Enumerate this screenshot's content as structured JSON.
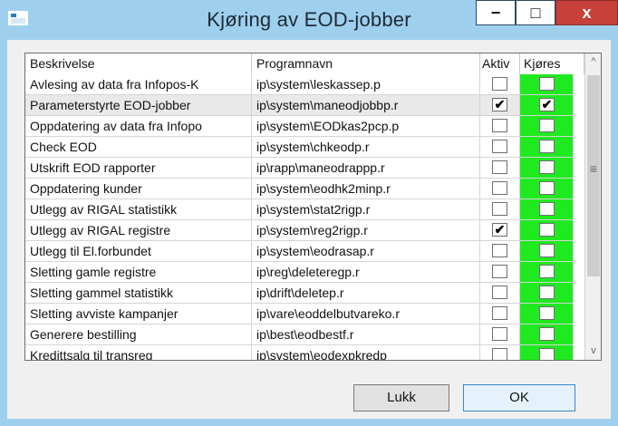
{
  "window": {
    "title": "Kjøring av EOD-jobber"
  },
  "titlebar": {
    "minimize": "−",
    "maximize": "□",
    "close": "x"
  },
  "grid": {
    "columns": [
      "Beskrivelse",
      "Programnavn",
      "Aktiv",
      "Kjøres"
    ],
    "rows": [
      {
        "desc": "Avlesing av data fra Infopos-K",
        "prog": "ip\\system\\leskassep.p",
        "aktiv": "",
        "kjores": ""
      },
      {
        "desc": "Parameterstyrte EOD-jobber",
        "prog": "ip\\system\\maneodjobbp.r",
        "aktiv": "✔",
        "kjores": "✔"
      },
      {
        "desc": "Oppdatering av data fra Infopo",
        "prog": "ip\\system\\EODkas2pcp.p",
        "aktiv": "",
        "kjores": ""
      },
      {
        "desc": "Check EOD",
        "prog": "ip\\system\\chkeodp.r",
        "aktiv": "",
        "kjores": ""
      },
      {
        "desc": "Utskrift EOD rapporter",
        "prog": "ip\\rapp\\maneodrappp.r",
        "aktiv": "",
        "kjores": ""
      },
      {
        "desc": "Oppdatering kunder",
        "prog": "ip\\system\\eodhk2minp.r",
        "aktiv": "",
        "kjores": ""
      },
      {
        "desc": "Utlegg av RIGAL statistikk",
        "prog": "ip\\system\\stat2rigp.r",
        "aktiv": "",
        "kjores": ""
      },
      {
        "desc": "Utlegg av RIGAL registre",
        "prog": "ip\\system\\reg2rigp.r",
        "aktiv": "✔",
        "kjores": ""
      },
      {
        "desc": "Utlegg til El.forbundet",
        "prog": "ip\\system\\eodrasap.r",
        "aktiv": "",
        "kjores": ""
      },
      {
        "desc": "Sletting gamle registre",
        "prog": "ip\\reg\\deleteregp.r",
        "aktiv": "",
        "kjores": ""
      },
      {
        "desc": "Sletting gammel statistikk",
        "prog": "ip\\drift\\deletep.r",
        "aktiv": "",
        "kjores": ""
      },
      {
        "desc": "Sletting avviste kampanjer",
        "prog": "ip\\vare\\eoddelbutvareko.r",
        "aktiv": "",
        "kjores": ""
      },
      {
        "desc": "Generere bestilling",
        "prog": "ip\\best\\eodbestf.r",
        "aktiv": "",
        "kjores": ""
      },
      {
        "desc": "Kredittsalg til transreg",
        "prog": "ip\\system\\eodexpkredp",
        "aktiv": "",
        "kjores": ""
      }
    ]
  },
  "scrollbar": {
    "up": "^",
    "down": "v",
    "grip": "≡"
  },
  "buttons": {
    "lukk": "Lukk",
    "ok": "OK"
  },
  "colors": {
    "kjores_bg": "#1fea1f",
    "window_frame": "#9ed0ee",
    "close_bg": "#c7403a"
  }
}
